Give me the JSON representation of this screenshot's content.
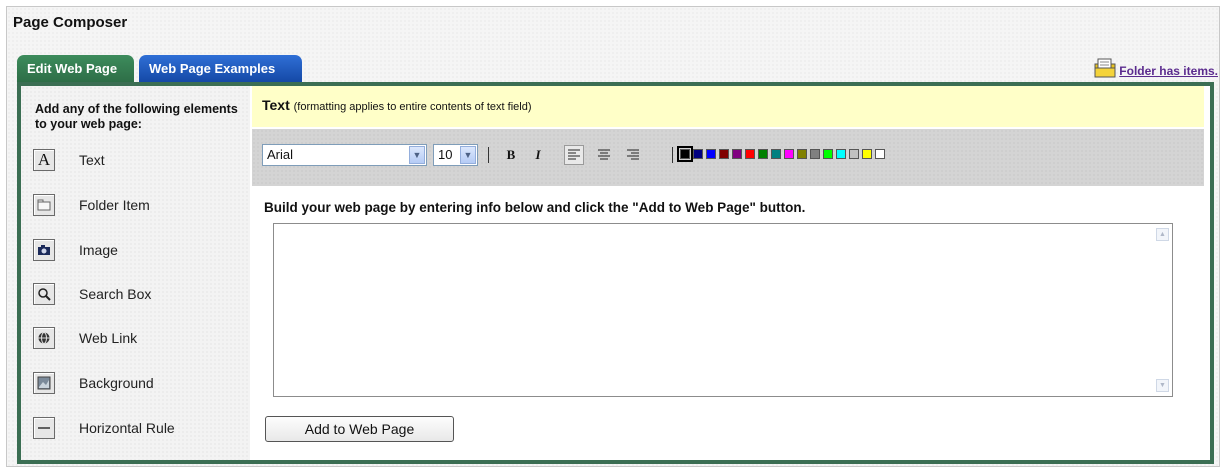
{
  "page_title": "Page Composer",
  "tabs": [
    {
      "label": "Edit Web Page",
      "active": true
    },
    {
      "label": "Web Page Examples",
      "active": false
    }
  ],
  "folder_link": {
    "label": "Folder has items.",
    "icon": "folder-items-icon"
  },
  "sidebar": {
    "heading": "Add any of the following elements to your web page:",
    "items": [
      {
        "label": "Text",
        "icon": "text-icon"
      },
      {
        "label": "Folder Item",
        "icon": "folder-item-icon"
      },
      {
        "label": "Image",
        "icon": "image-icon"
      },
      {
        "label": "Search Box",
        "icon": "search-icon"
      },
      {
        "label": "Web Link",
        "icon": "web-link-icon"
      },
      {
        "label": "Background",
        "icon": "background-icon"
      },
      {
        "label": "Horizontal Rule",
        "icon": "horizontal-rule-icon"
      }
    ]
  },
  "section": {
    "title": "Text",
    "note": "(formatting applies to entire contents of text field)"
  },
  "toolbar": {
    "font_value": "Arial",
    "size_value": "10",
    "bold_label": "B",
    "italic_label": "I",
    "align_icons": [
      "align-left-icon",
      "align-center-icon",
      "align-right-icon"
    ],
    "colors": [
      "#000000",
      "#000080",
      "#0000ff",
      "#800000",
      "#800080",
      "#ff0000",
      "#008000",
      "#008080",
      "#ff00ff",
      "#808000",
      "#808080",
      "#00ff00",
      "#00ffff",
      "#c0c0c0",
      "#ffff00",
      "#ffffff"
    ]
  },
  "instruction": "Build your web page by entering info below and click the \"Add to Web Page\" button.",
  "text_field": {
    "value": ""
  },
  "add_button": {
    "label": "Add to Web Page"
  },
  "colors": {
    "tab_edit": "#3a8757",
    "tab_examples": "#2160c4",
    "panel_border": "#3b6e53",
    "header_bg": "#ffffc8",
    "link": "#5b2b8e"
  }
}
